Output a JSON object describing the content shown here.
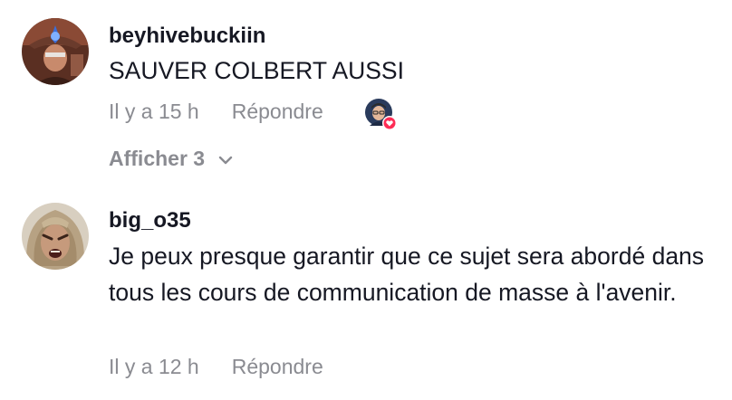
{
  "comments": [
    {
      "username": "beyhivebuckiin",
      "text": "SAUVER COLBERT AUSSI",
      "time": "Il y a 15 h",
      "reply_label": "Répondre",
      "creator_liked_icon": "creator-avatar-heart-icon",
      "show_replies_label": "Afficher 3"
    },
    {
      "username": "big_o35",
      "text": "Je peux presque garantir que ce sujet sera abordé dans tous les cours de communication de masse à l'avenir.",
      "time": "Il y a 12 h",
      "reply_label": "Répondre"
    }
  ],
  "colors": {
    "text_primary": "#161823",
    "text_secondary": "#8a8b91",
    "like_badge": "#fe2c55"
  }
}
